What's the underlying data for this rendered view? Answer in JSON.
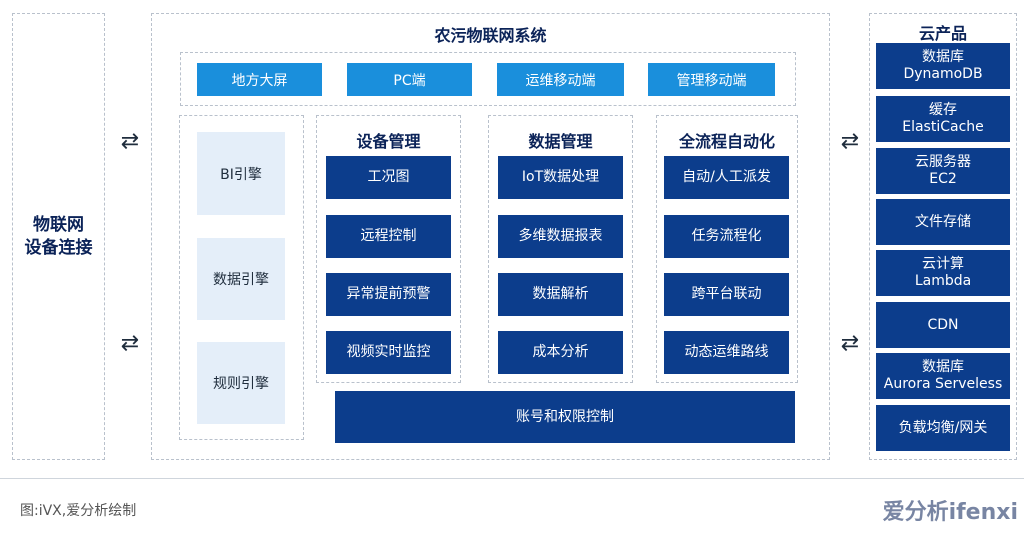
{
  "left": {
    "label": "物联网\n设备连接"
  },
  "main": {
    "title": "农污物联网系统",
    "terminals": [
      "地方大屏",
      "PC端",
      "运维移动端",
      "管理移动端"
    ],
    "engines": [
      "BI引擎",
      "数据引擎",
      "规则引擎"
    ],
    "device": {
      "title": "设备管理",
      "items": [
        "工况图",
        "远程控制",
        "异常提前预警",
        "视频实时监控"
      ]
    },
    "data": {
      "title": "数据管理",
      "items": [
        "IoT数据处理",
        "多维数据报表",
        "数据解析",
        "成本分析"
      ]
    },
    "auto": {
      "title": "全流程自动化",
      "items": [
        "自动/人工派发",
        "任务流程化",
        "跨平台联动",
        "动态运维路线"
      ]
    },
    "account": "账号和权限控制"
  },
  "cloud": {
    "title": "云产品",
    "items": [
      "数据库\nDynamoDB",
      "缓存\nElastiCache",
      "云服务器\nEC2",
      "文件存储",
      "云计算\nLambda",
      "CDN",
      "数据库\nAurora Serveless",
      "负载均衡/网关"
    ]
  },
  "footer": {
    "source": "图:iVX,爱分析绘制"
  },
  "watermark": {
    "text": "爱分析ifenxi"
  },
  "colors": {
    "navy": "#0c3d8c",
    "lightblue": "#1a8fdc",
    "pale": "#e4eef9",
    "dashed": "#b9c1cc"
  },
  "icons": {
    "arrows": "bidirectional-arrow-icon"
  }
}
